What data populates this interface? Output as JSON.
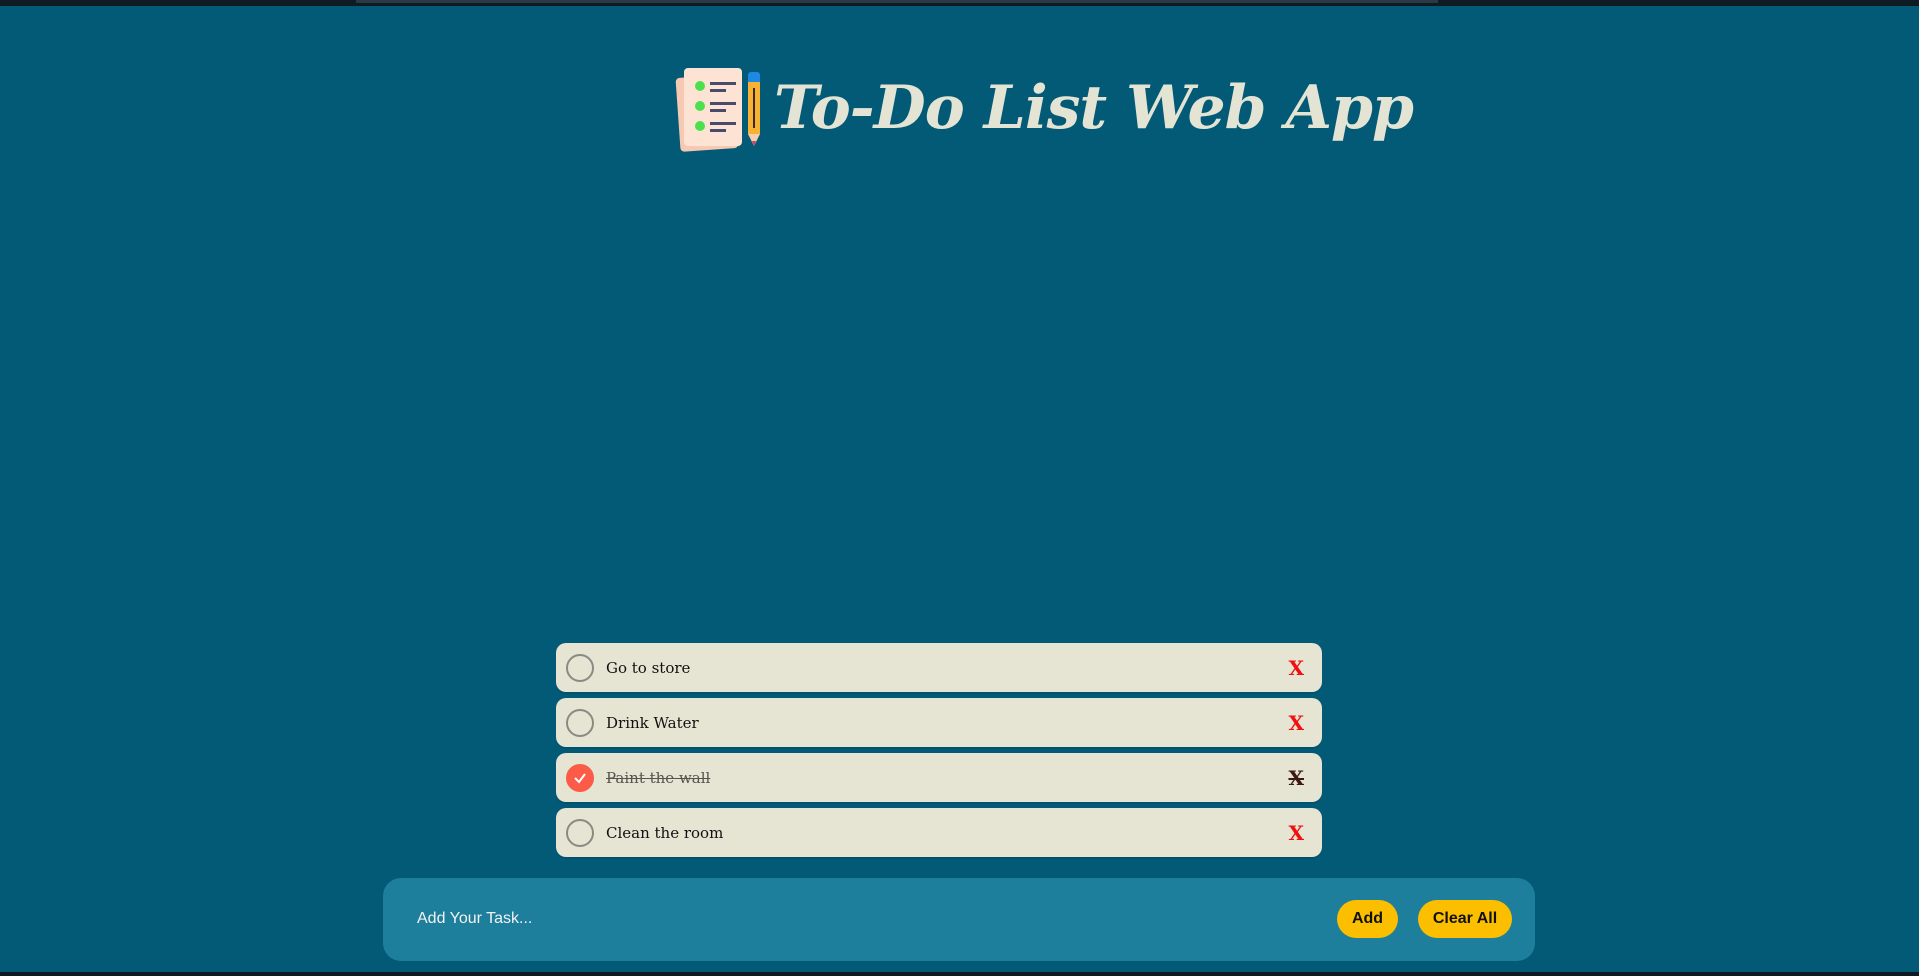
{
  "header": {
    "title": "To-Do List Web App",
    "logo_icon": "checklist-pencil-icon"
  },
  "colors": {
    "background": "#025a76",
    "task_bg": "#e6e5d3",
    "input_bar": "#1e7f9c",
    "button": "#fbbf00",
    "checked": "#fb5b47",
    "delete": "#f01010",
    "title": "#e4e4d4"
  },
  "tasks": [
    {
      "text": "Go to store",
      "done": false,
      "delete_label": "X"
    },
    {
      "text": "Drink Water",
      "done": false,
      "delete_label": "X"
    },
    {
      "text": "Paint the wall",
      "done": true,
      "delete_label": "X"
    },
    {
      "text": "Clean the room",
      "done": false,
      "delete_label": "X"
    }
  ],
  "input": {
    "placeholder": "Add Your Task...",
    "value": ""
  },
  "buttons": {
    "add_label": "Add",
    "clear_label": "Clear All"
  }
}
